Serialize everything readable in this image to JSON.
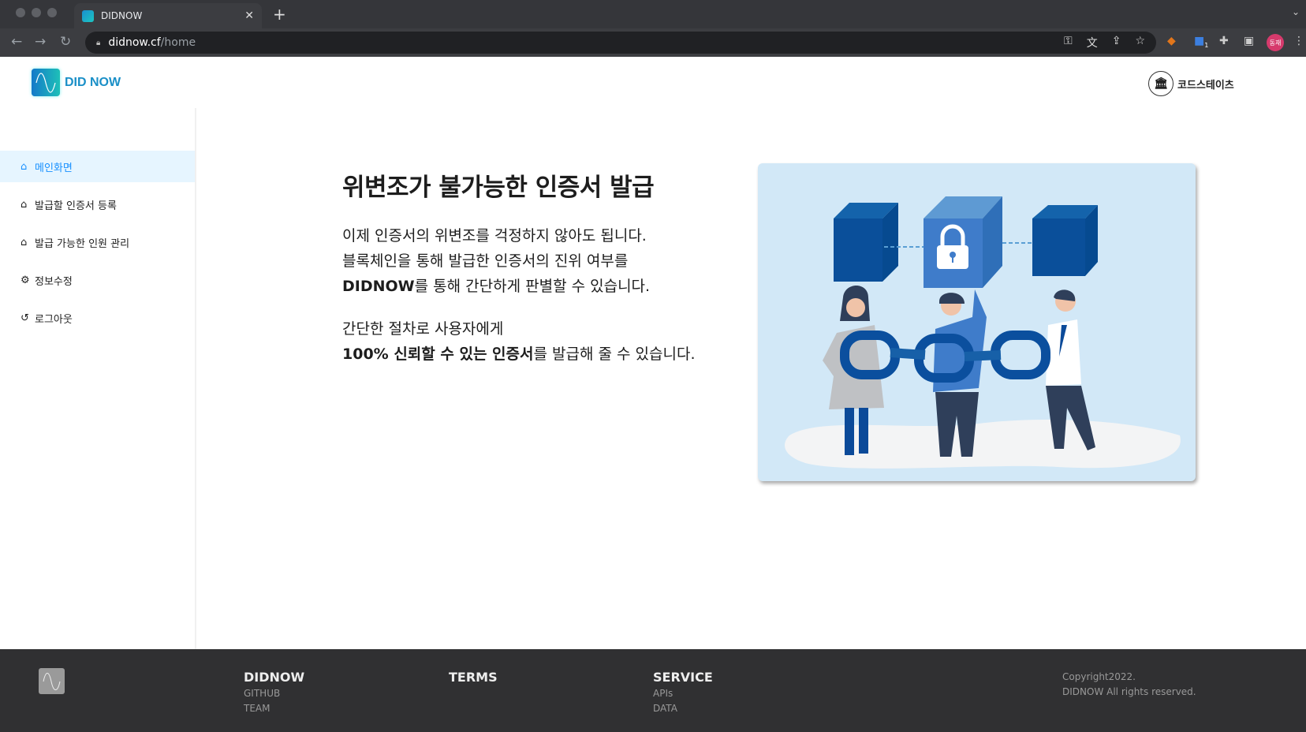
{
  "browser": {
    "tab_title": "DIDNOW",
    "url_host": "didnow.cf",
    "url_path": "/home",
    "profile": "동재",
    "ext_badge": "1"
  },
  "header": {
    "brand": "DID NOW",
    "org": "코드스테이츠"
  },
  "sidebar": {
    "items": [
      {
        "label": "메인화면",
        "icon": "home-icon",
        "active": true
      },
      {
        "label": "발급할 인증서 등록",
        "icon": "home-icon"
      },
      {
        "label": "발급 가능한 인원 관리",
        "icon": "home-icon"
      },
      {
        "label": "정보수정",
        "icon": "gear-icon"
      },
      {
        "label": "로그아웃",
        "icon": "logout-icon"
      }
    ]
  },
  "hero": {
    "title": "위변조가 불가능한 인증서 발급",
    "p1": [
      "이제 인증서의 위변조를 걱정하지 않아도 됩니다.",
      "블록체인을 통해 발급한 인증서의 진위 여부를"
    ],
    "p1_brand": "DIDNOW",
    "p1_rest": "를 통해 간단하게 판별할 수 있습니다.",
    "p2": "간단한 절차로 사용자에게",
    "p2_bold": "100% 신뢰할 수 있는 인증서",
    "p2_rest": "를 발급해 줄 수 있습니다."
  },
  "footer": {
    "cols": [
      {
        "title": "DIDNOW",
        "links": [
          "GITHUB",
          "TEAM"
        ]
      },
      {
        "title": "TERMS",
        "links": []
      },
      {
        "title": "SERVICE",
        "links": [
          "APIs",
          "DATA"
        ]
      }
    ],
    "copyright": [
      "Copyright2022.",
      "DIDNOW All rights reserved."
    ]
  },
  "colors": {
    "accent": "#1890ff",
    "footer_bg": "#303032",
    "card_bg": "#d2e8f7"
  }
}
